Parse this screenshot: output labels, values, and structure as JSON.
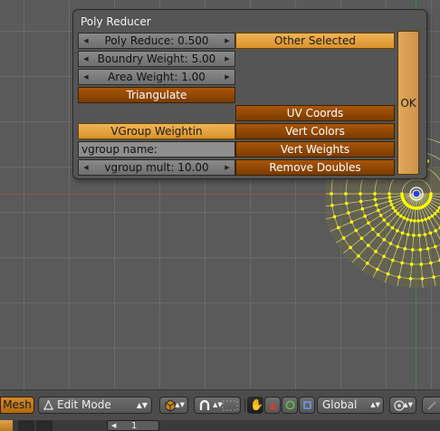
{
  "dialog": {
    "title": "Poly Reducer",
    "poly_reduce": "Poly Reduce: 0.500",
    "boundry_weight": "Boundry Weight: 5.00",
    "area_weight": "Area Weight: 1.00",
    "triangulate": "Triangulate",
    "other_selected": "Other Selected",
    "uv_coords": "UV Coords",
    "vgroup_weighting": "VGroup Weightin",
    "vert_colors": "Vert Colors",
    "vgroup_name": "vgroup name:",
    "vert_weights": "Vert Weights",
    "vgroup_mult": "vgroup mult: 10.00",
    "remove_doubles": "Remove Doubles",
    "ok": "OK"
  },
  "header": {
    "mesh": "Mesh",
    "mode": "Edit Mode",
    "orientation": "Global"
  },
  "strip": {
    "layer_value": "1"
  },
  "icons": [
    "edit-mode-triangle-icon",
    "cube-shading-icon",
    "magnet-icon",
    "vertex-select-icon",
    "hand-icon",
    "rotate-icon",
    "translate-icon",
    "scale-icon",
    "pivot-icon",
    "snap-icon"
  ],
  "colors": {
    "button_orange": "#a9560a",
    "button_orange_on": "#e0a34a",
    "mesh_vertex": "#ffff00",
    "x_axis": "#a04848",
    "y_axis": "#3f8a3f"
  }
}
